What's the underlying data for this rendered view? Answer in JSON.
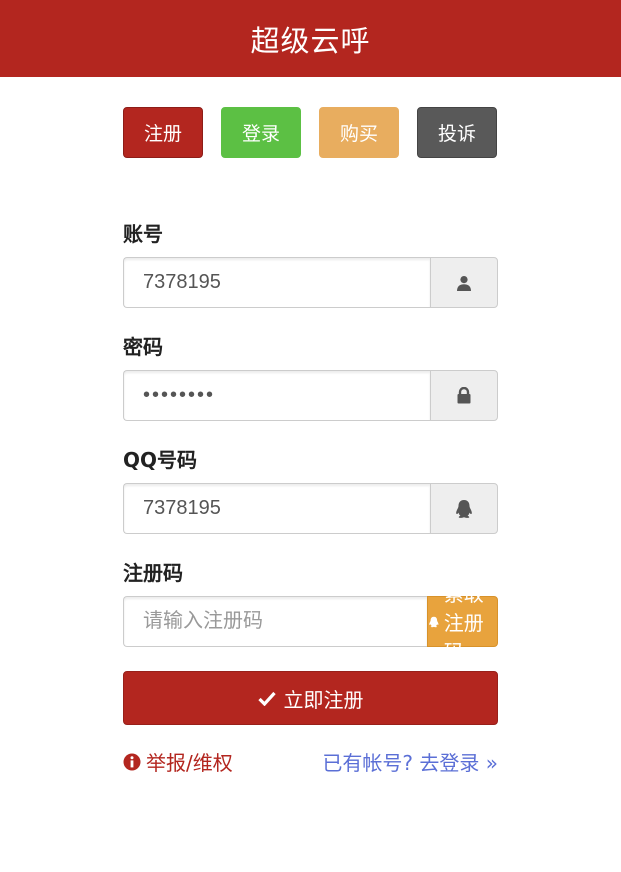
{
  "header": {
    "title": "超级云呼"
  },
  "nav": {
    "register": "注册",
    "login": "登录",
    "buy": "购买",
    "complaint": "投诉"
  },
  "form": {
    "account": {
      "label": "账号",
      "value": "7378195",
      "icon": "user-icon"
    },
    "password": {
      "label": "密码",
      "value": "12345678",
      "icon": "lock-icon"
    },
    "qq": {
      "label": "QQ号码",
      "value": "7378195",
      "icon": "qq-penguin-icon"
    },
    "reg_code": {
      "label": "注册码",
      "placeholder": "请输入注册码",
      "button": "索取注册码",
      "icon": "qq-penguin-icon"
    },
    "submit": {
      "label": "立即注册",
      "icon": "check-icon"
    }
  },
  "footer": {
    "report": "举报/维权",
    "report_icon": "info-circle-icon",
    "login_link": "已有帐号? 去登录 »"
  },
  "colors": {
    "brand": "#b3261f",
    "green": "#5cc044",
    "orange": "#e8ad5f",
    "gray": "#595959",
    "link": "#5b6fd6"
  }
}
